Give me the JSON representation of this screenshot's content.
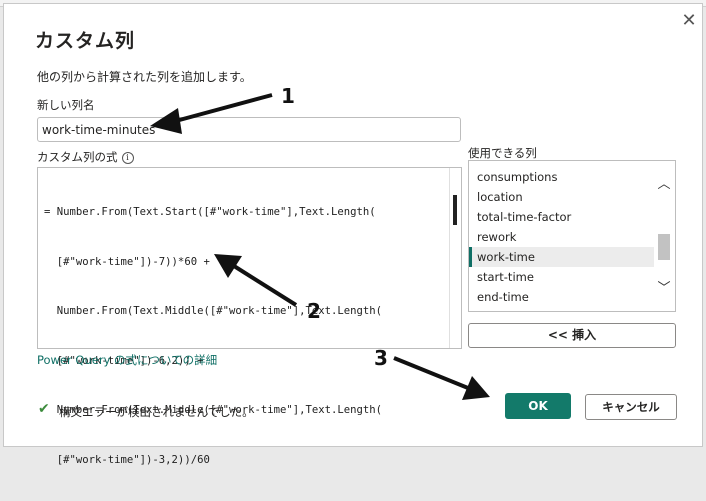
{
  "dialog": {
    "title": "カスタム列",
    "close_glyph": "✕",
    "description": "他の列から計算された列を追加します。",
    "name_label": "新しい列名",
    "name_value": "work-time-minutes",
    "formula_label": "カスタム列の式",
    "info_glyph": "i",
    "formula_lines": [
      "= Number.From(Text.Start([#\"work-time\"],Text.Length(",
      "  [#\"work-time\"])-7))*60 +",
      "  Number.From(Text.Middle([#\"work-time\"],Text.Length(",
      "  [#\"work-time\"])-6,2)) +",
      "  Number.From(Text.Middle([#\"work-time\"],Text.Length(",
      "  [#\"work-time\"])-3,2))/60"
    ],
    "help_link": "Power Query の式についての詳細",
    "columns_label": "使用できる列",
    "columns": [
      "consumptions",
      "location",
      "total-time-factor",
      "rework",
      "work-time",
      "start-time",
      "end-time"
    ],
    "selected_column": "work-time",
    "insert_button": "<< 挿入",
    "status_text": "構文エラーが検出されませんでした。",
    "check_glyph": "✔",
    "ok_button": "OK",
    "cancel_button": "キャンセル"
  },
  "annotations": {
    "one": "1",
    "two": "2",
    "three": "3"
  },
  "colors": {
    "accent": "#137a6a",
    "link": "#0f6f65",
    "check": "#3c8b3c"
  },
  "icons": {
    "up_arrow": "︿",
    "down_arrow": "﹀"
  }
}
